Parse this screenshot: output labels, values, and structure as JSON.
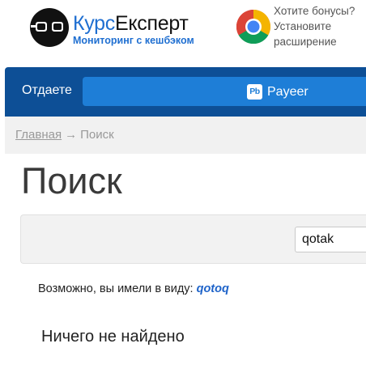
{
  "header": {
    "brand_part1": "Курс",
    "brand_part2": "Експерт",
    "tagline": "Мониторинг с кешбэком",
    "logo_icon": "glasses-icon",
    "promo": {
      "icon": "chrome-icon",
      "text": "Хотите бонусы? Установите расширение"
    }
  },
  "exchange": {
    "give_label": "Отдаете",
    "currency_badge": "Pb",
    "currency_label": "Payeer"
  },
  "breadcrumb": {
    "home": "Главная",
    "separator": "→",
    "current": "Поиск"
  },
  "main": {
    "title": "Поиск",
    "search_value": "qotak",
    "suggestion_prefix": "Возможно, вы имели в виду:",
    "suggestion_term": "qotoq",
    "no_results": "Ничего не найдено"
  },
  "colors": {
    "brand_blue": "#1f6fd1",
    "bar_dark": "#0d4f96",
    "select_blue": "#1e7ed7",
    "link_blue": "#1e63c9"
  }
}
